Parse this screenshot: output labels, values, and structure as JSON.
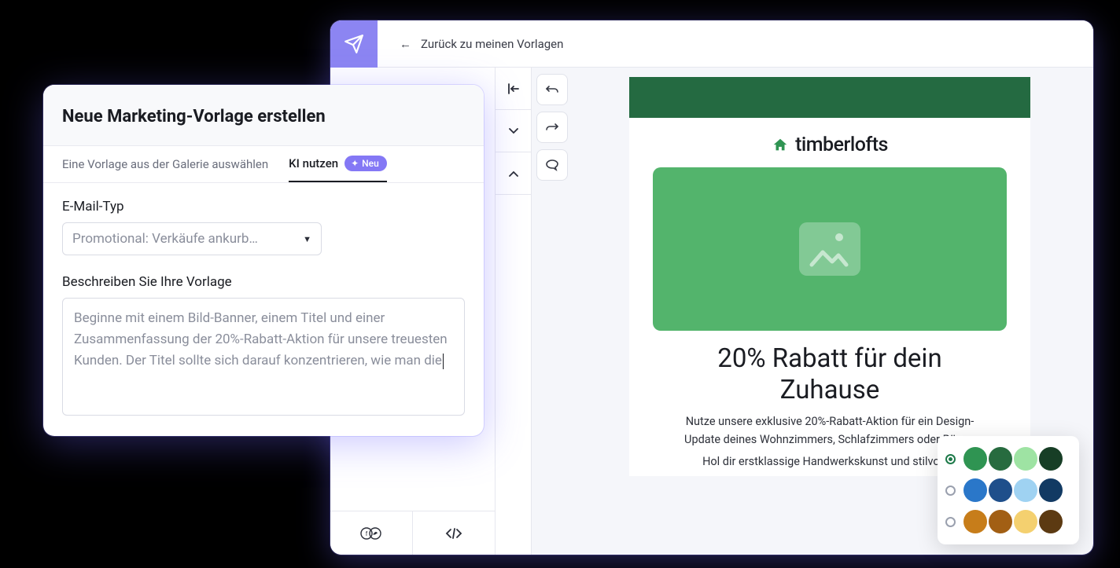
{
  "editor": {
    "back_label": "Zurück zu meinen Vorlagen",
    "email": {
      "brand": "timberlofts",
      "headline": "20% Rabatt für dein Zuhause",
      "para1": "Nutze unsere exklusive 20%-Rabatt-Aktion für ein Design-Update deines Wohnzimmers, Schlafzimmers oder Büros.",
      "para2": "Hol dir erstklassige Handwerkskunst und stilvolles"
    }
  },
  "modal": {
    "title": "Neue Marketing-Vorlage erstellen",
    "tab_gallery": "Eine Vorlage aus der Galerie auswählen",
    "tab_ai": "KI nutzen",
    "badge_new": "Neu",
    "email_type_label": "E-Mail-Typ",
    "email_type_value": "Promotional: Verkäufe ankurb…",
    "describe_label": "Beschreiben Sie Ihre Vorlage",
    "describe_value": "Beginne mit einem Bild-Banner, einem Titel und einer Zusammenfassung der 20%-Rabatt-Aktion für unsere treuesten Kunden. Der Titel sollte sich darauf konzentrieren, wie man die"
  },
  "palette": {
    "rows": [
      {
        "selected": true,
        "colors": [
          "#2f9452",
          "#276b3f",
          "#9ee3a3",
          "#173e26"
        ]
      },
      {
        "selected": false,
        "colors": [
          "#2a77c9",
          "#1f4f8b",
          "#9fd2f2",
          "#123a63"
        ]
      },
      {
        "selected": false,
        "colors": [
          "#c77d1a",
          "#a25f14",
          "#f4d06f",
          "#5c3a12"
        ]
      }
    ]
  }
}
